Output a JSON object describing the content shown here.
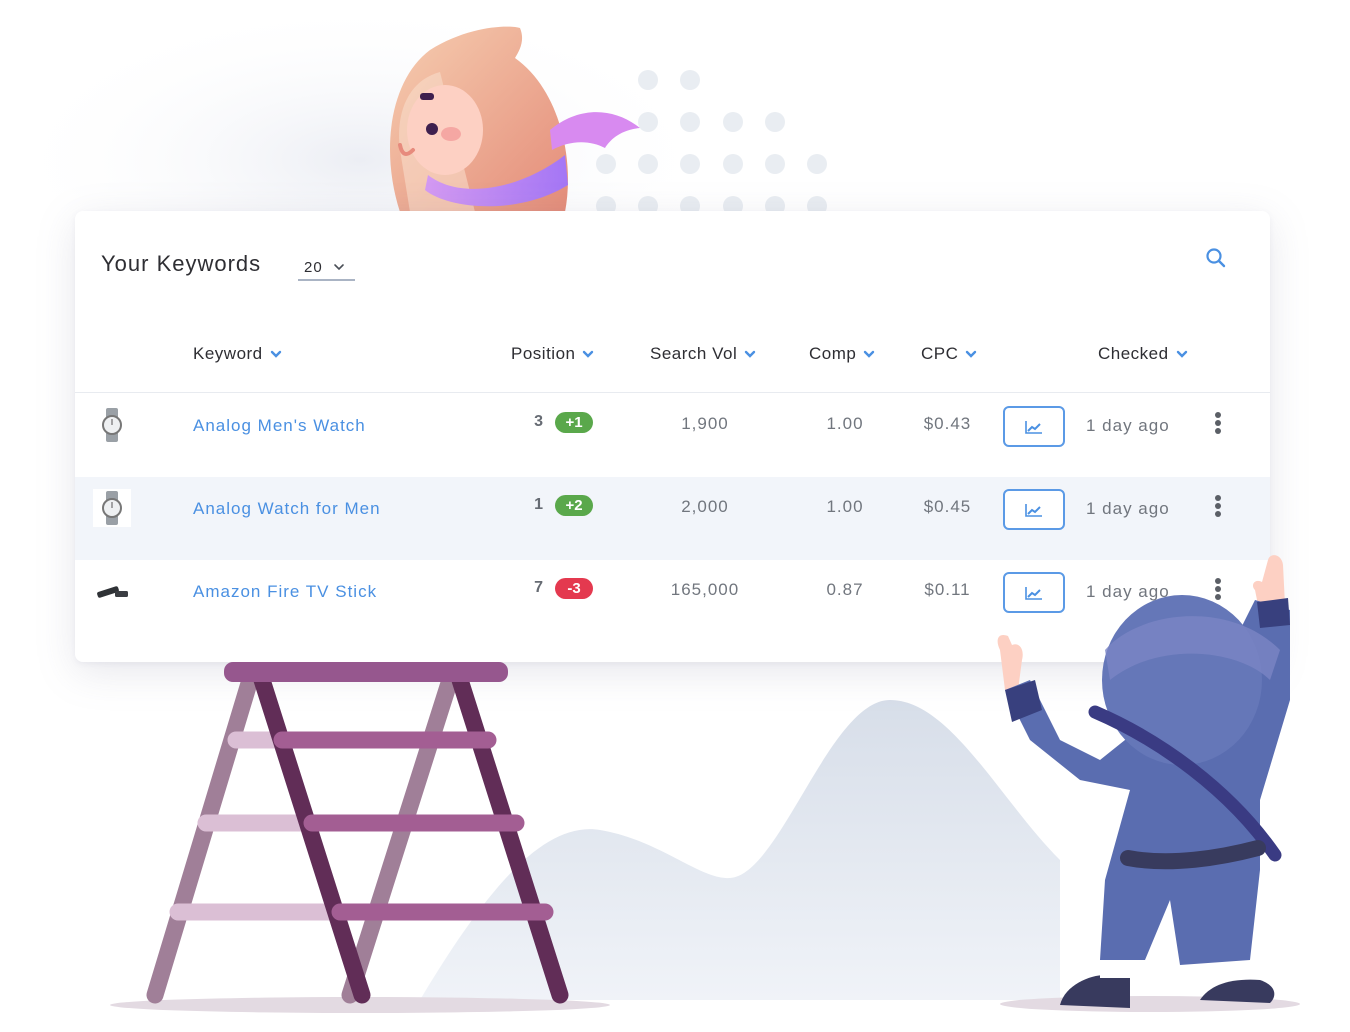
{
  "header": {
    "title": "Your Keywords",
    "page_size_value": "20",
    "search_icon": "search-icon"
  },
  "columns": [
    {
      "label": "Keyword",
      "sort_icon": "chevron-down-icon"
    },
    {
      "label": "Position",
      "sort_icon": "chevron-down-icon"
    },
    {
      "label": "Search Vol",
      "sort_icon": "chevron-down-icon"
    },
    {
      "label": "Comp",
      "sort_icon": "chevron-down-icon"
    },
    {
      "label": "CPC",
      "sort_icon": "chevron-down-icon"
    },
    {
      "label": "Checked",
      "sort_icon": "chevron-down-icon"
    }
  ],
  "rows": [
    {
      "thumbnail": "watch-image",
      "keyword": "Analog Men's Watch",
      "position": "3",
      "change": "+1",
      "trend": "up",
      "search_vol": "1,900",
      "comp": "1.00",
      "cpc": "$0.43",
      "checked": "1 day ago"
    },
    {
      "thumbnail": "watch-image",
      "keyword": "Analog Watch for Men",
      "position": "1",
      "change": "+2",
      "trend": "up",
      "search_vol": "2,000",
      "comp": "1.00",
      "cpc": "$0.45",
      "checked": "1 day ago"
    },
    {
      "thumbnail": "fire-tv-stick-image",
      "keyword": "Amazon Fire TV Stick",
      "position": "7",
      "change": "-3",
      "trend": "down",
      "search_vol": "165,000",
      "comp": "0.87",
      "cpc": "$0.11",
      "checked": "1 day ago"
    }
  ],
  "row_actions": {
    "chart_icon": "line-chart-icon",
    "more_icon": "more-vertical-icon"
  },
  "colors": {
    "accent": "#4a90e2",
    "badge_up": "#5aa84b",
    "badge_down": "#e4394f",
    "row_alt": "#f2f5fa",
    "ladder_dark": "#612d57",
    "ladder_light": "#a05d94",
    "ninja_suit": "#5a6db0",
    "character_head": "#eea286",
    "scarf": "#b37ef0"
  }
}
